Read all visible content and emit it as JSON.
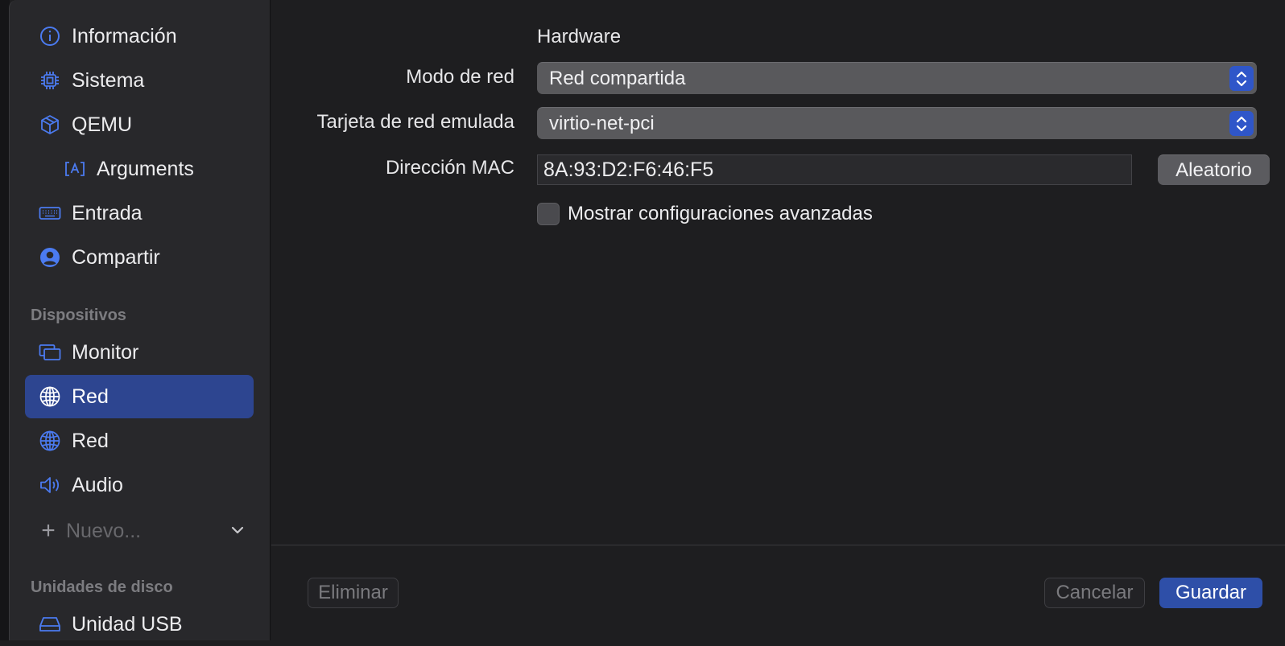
{
  "sidebar": {
    "items": [
      {
        "label": "Información",
        "icon": "info-circle-icon"
      },
      {
        "label": "Sistema",
        "icon": "cpu-chip-icon"
      },
      {
        "label": "QEMU",
        "icon": "cube-icon"
      },
      {
        "label": "Arguments",
        "icon": "text-box-icon"
      },
      {
        "label": "Entrada",
        "icon": "keyboard-icon"
      },
      {
        "label": "Compartir",
        "icon": "person-circle-icon"
      }
    ],
    "devices_header": "Dispositivos",
    "devices": [
      {
        "label": "Monitor",
        "icon": "display-icon"
      },
      {
        "label": "Red",
        "icon": "globe-icon",
        "selected": true
      },
      {
        "label": "Red",
        "icon": "globe-icon"
      },
      {
        "label": "Audio",
        "icon": "speaker-icon"
      }
    ],
    "new_label": "Nuevo...",
    "drives_header": "Unidades de disco",
    "drives": [
      {
        "label": "Unidad USB",
        "icon": "drive-icon"
      }
    ]
  },
  "main": {
    "section_title": "Hardware",
    "network_mode": {
      "label": "Modo de red",
      "value": "Red compartida"
    },
    "emulated_card": {
      "label": "Tarjeta de red emulada",
      "value": "virtio-net-pci"
    },
    "mac_address": {
      "label": "Dirección MAC",
      "value": "8A:93:D2:F6:46:F5",
      "random_button": "Aleatorio"
    },
    "advanced_checkbox": {
      "label": "Mostrar configuraciones avanzadas",
      "checked": false
    }
  },
  "footer": {
    "delete_button": "Eliminar",
    "cancel_button": "Cancelar",
    "save_button": "Guardar"
  },
  "colors": {
    "accent": "#2f56c9",
    "selected_row": "#2d4590",
    "icon_blue": "#4b7bf0"
  }
}
